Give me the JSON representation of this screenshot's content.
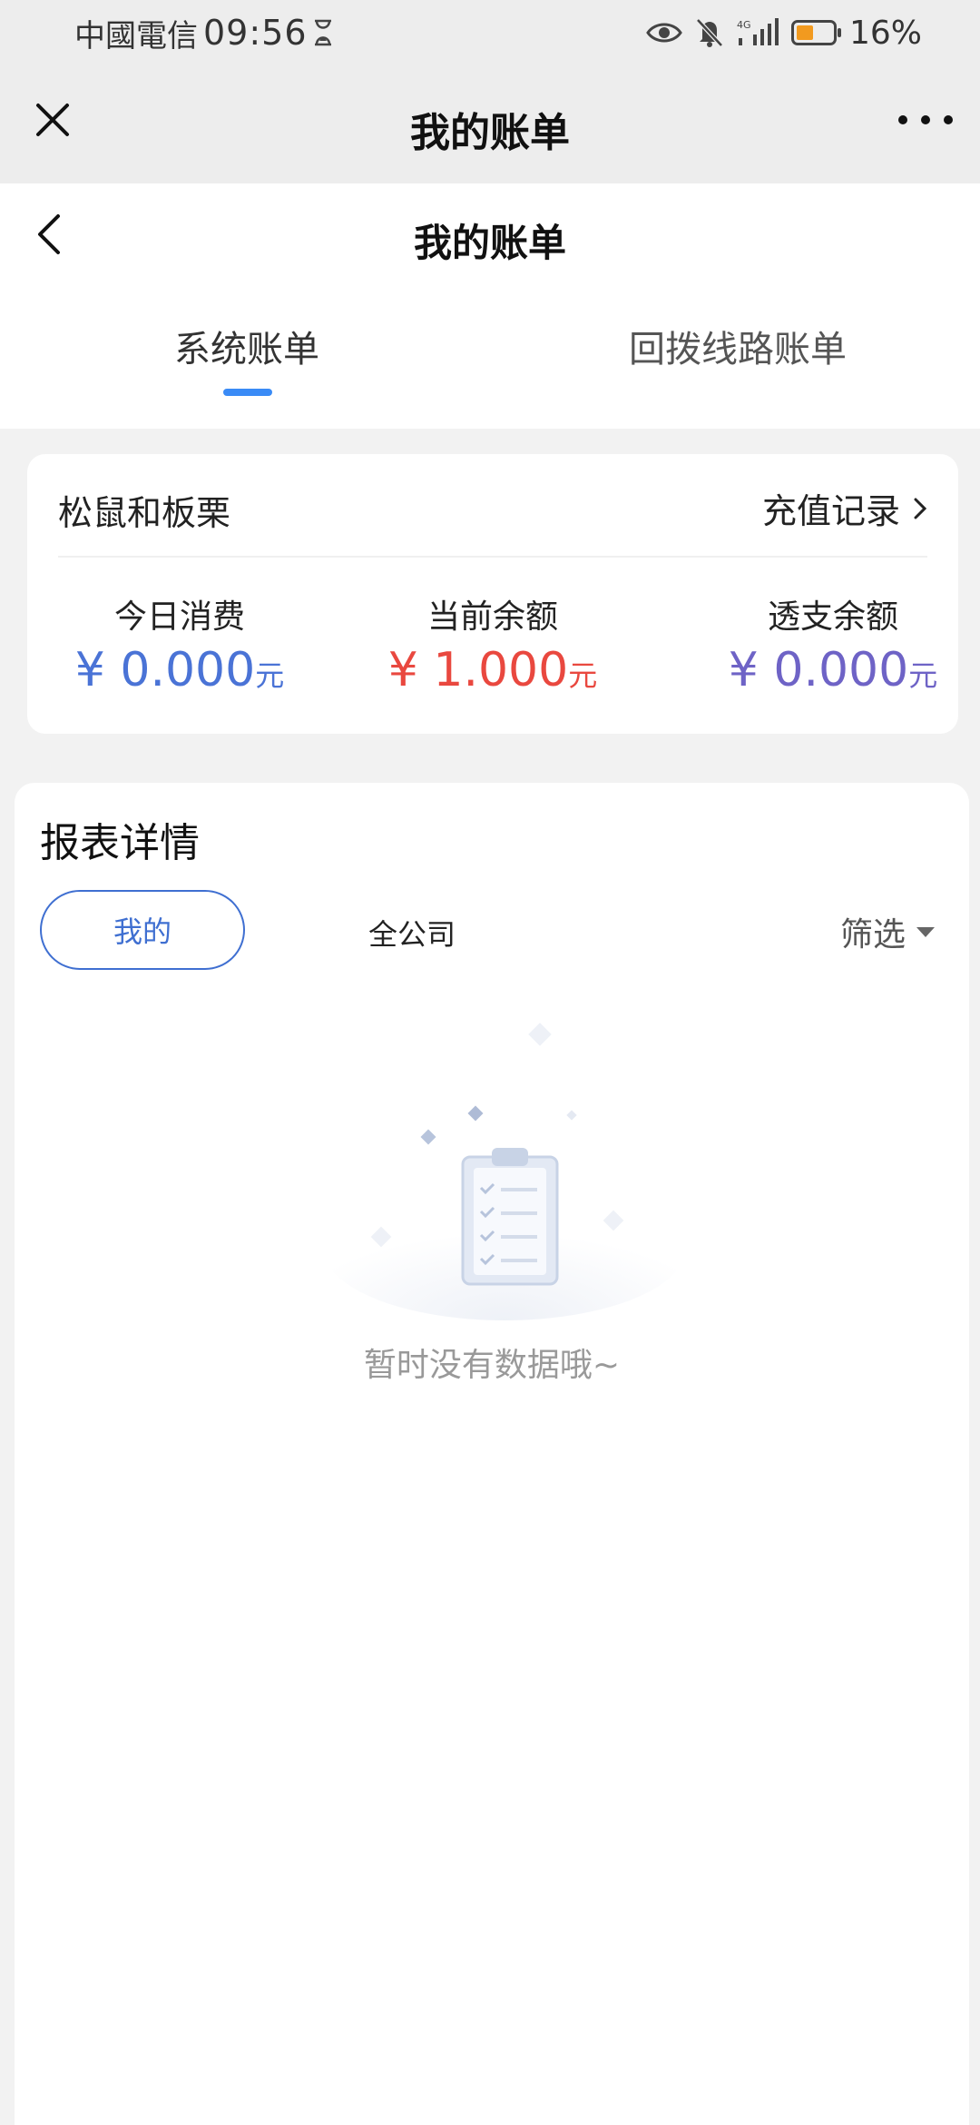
{
  "status_bar": {
    "carrier": "中國電信",
    "time": "09:56",
    "network": "4G",
    "battery": "16%",
    "battery_level": 0.16
  },
  "navbar": {
    "title": "我的账单"
  },
  "header": {
    "title": "我的账单",
    "tabs": [
      {
        "label": "系统账单",
        "active": true
      },
      {
        "label": "回拨线路账单",
        "active": false
      }
    ]
  },
  "balance_card": {
    "account_name": "松鼠和板栗",
    "recharge_link": "充值记录",
    "stats": [
      {
        "label": "今日消费",
        "currency": "¥",
        "amount": "0.000",
        "unit": "元",
        "color": "#4a73d6"
      },
      {
        "label": "当前余额",
        "currency": "¥",
        "amount": "1.000",
        "unit": "元",
        "color": "#e9483f"
      },
      {
        "label": "透支余额",
        "currency": "¥",
        "amount": "0.000",
        "unit": "元",
        "color": "#6e63c6"
      }
    ]
  },
  "report": {
    "title": "报表详情",
    "scope_options": [
      {
        "label": "我的",
        "selected": true
      },
      {
        "label": "全公司",
        "selected": false
      }
    ],
    "filter_label": "筛选",
    "empty_text": "暂时没有数据哦~"
  },
  "icons": [
    "close-icon",
    "more-icon",
    "back-icon",
    "chevron-right-icon",
    "eye-icon",
    "bell-off-icon",
    "signal-icon",
    "battery-icon",
    "hourglass-icon",
    "caret-down-icon",
    "empty-clipboard-icon"
  ]
}
